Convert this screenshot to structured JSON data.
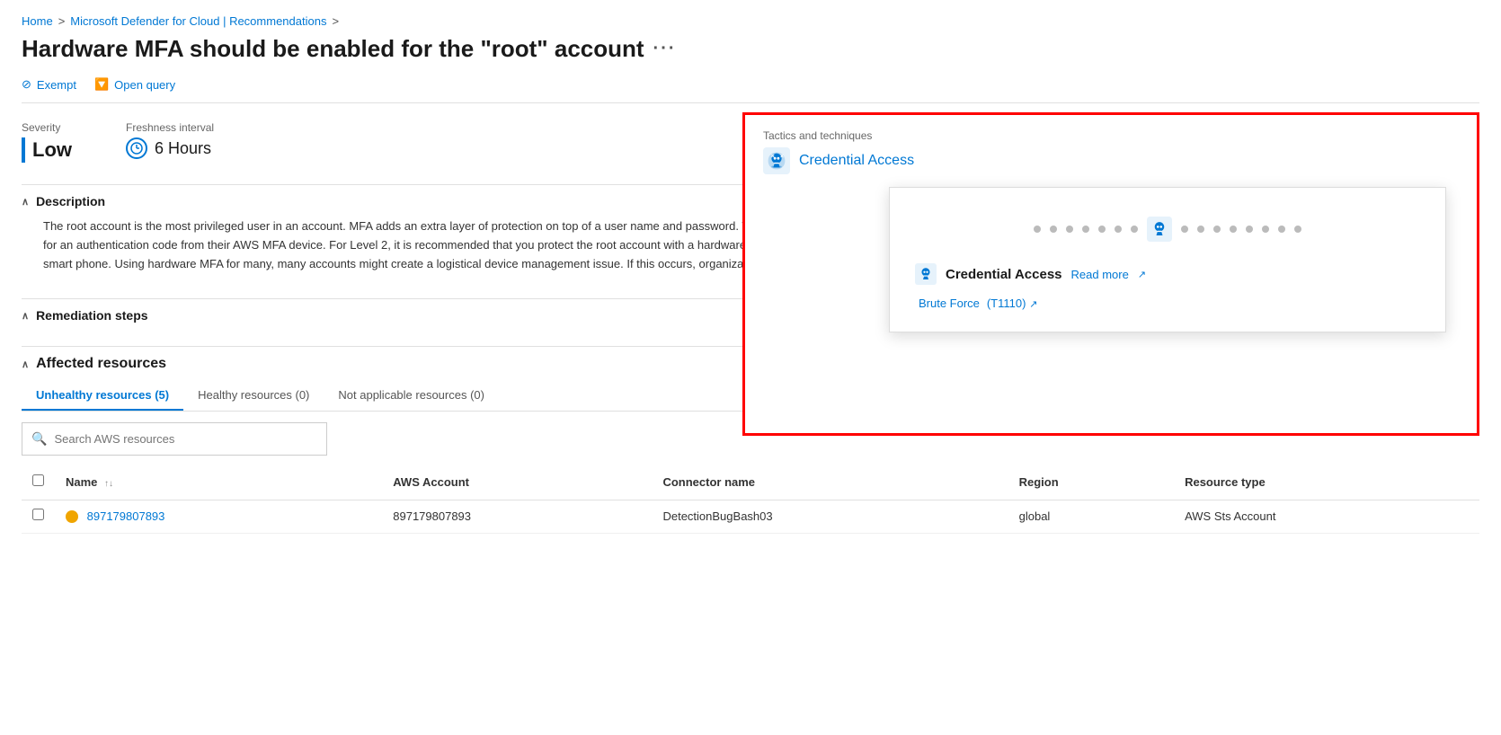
{
  "breadcrumb": {
    "home": "Home",
    "separator1": ">",
    "recommendations": "Microsoft Defender for Cloud | Recommendations",
    "separator2": ">"
  },
  "page": {
    "title": "Hardware MFA should be enabled for the \"root\" account",
    "ellipsis": "···"
  },
  "toolbar": {
    "exempt_label": "Exempt",
    "open_query_label": "Open query"
  },
  "severity": {
    "label": "Severity",
    "value": "Low"
  },
  "freshness": {
    "label": "Freshness interval",
    "value": "6 Hours"
  },
  "tactics": {
    "label": "Tactics and techniques",
    "name": "Credential Access",
    "tooltip": {
      "title": "Credential Access",
      "read_more": "Read more",
      "technique_label": "Brute Force",
      "technique_code": "(T1110)",
      "dots_count": 15
    }
  },
  "description": {
    "header": "Description",
    "text": "The root account is the most privileged user in an account. MFA adds an extra layer of protection on top of a user name and password. With MFA enabled, when a user signs in to an AWS Management Console, they will be prompted for their user name and password as well as for an authentication code from their AWS MFA device. For Level 2, it is recommended that you protect the root account with a hardware MFA. A hardware MFA has a smaller attack surface than a virtual MFA. For example, a hardware MFA does not suffer the attack surface in a smart phone. Using hardware MFA for many, many accounts might create a logistical device management issue. If this occurs, organizations can consider implementing virtual MFA for accounts. You can"
  },
  "remediation": {
    "header": "Remediation steps"
  },
  "affected_resources": {
    "header": "Affected resources",
    "tabs": [
      {
        "label": "Unhealthy resources (5)",
        "active": true
      },
      {
        "label": "Healthy resources (0)",
        "active": false
      },
      {
        "label": "Not applicable resources (0)",
        "active": false
      }
    ],
    "search_placeholder": "Search AWS resources",
    "table": {
      "columns": [
        {
          "label": "Name",
          "sortable": true
        },
        {
          "label": "AWS Account",
          "sortable": false
        },
        {
          "label": "Connector name",
          "sortable": false
        },
        {
          "label": "Region",
          "sortable": false
        },
        {
          "label": "Resource type",
          "sortable": false
        }
      ],
      "rows": [
        {
          "name": "897179807893",
          "aws_account": "897179807893",
          "connector_name": "DetectionBugBash03",
          "region": "global",
          "resource_type": "AWS Sts Account"
        }
      ]
    }
  }
}
